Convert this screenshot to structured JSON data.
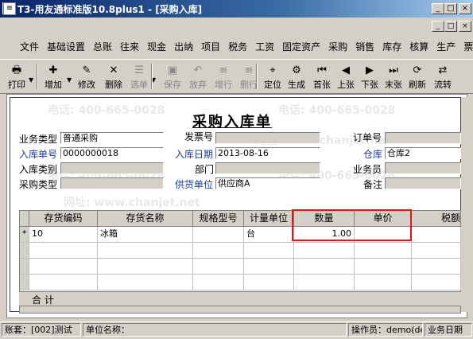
{
  "window": {
    "title": "T3-用友通标准版10.8plus1 - [采购入库]",
    "controls": [
      "_",
      "□",
      "×"
    ]
  },
  "mdi_controls": [
    "_",
    "□",
    "×"
  ],
  "menu": [
    "文件",
    "基础设置",
    "总账",
    "往来",
    "现金",
    "出纳",
    "项目",
    "税务",
    "工资",
    "固定资产",
    "采购",
    "销售",
    "库存",
    "核算",
    "生产",
    "票据"
  ],
  "toolbar": [
    {
      "label": "打印",
      "icon": "printer-icon",
      "glyph": "🖶",
      "enabled": true
    },
    {
      "label": "增加",
      "icon": "add-doc-icon",
      "glyph": "✚",
      "enabled": true
    },
    {
      "label": "修改",
      "icon": "edit-icon",
      "glyph": "✎",
      "enabled": true
    },
    {
      "label": "删除",
      "icon": "delete-icon",
      "glyph": "✕",
      "enabled": true
    },
    {
      "label": "选单",
      "icon": "select-icon",
      "glyph": "☰",
      "enabled": false
    },
    {
      "label": "保存",
      "icon": "save-icon",
      "glyph": "▣",
      "enabled": false
    },
    {
      "label": "放弃",
      "icon": "discard-icon",
      "glyph": "↶",
      "enabled": false
    },
    {
      "label": "增行",
      "icon": "add-row-icon",
      "glyph": "≡",
      "enabled": false
    },
    {
      "label": "删行",
      "icon": "delete-row-icon",
      "glyph": "≡",
      "enabled": false
    },
    {
      "label": "定位",
      "icon": "locate-icon",
      "glyph": "⌖",
      "enabled": true
    },
    {
      "label": "生成",
      "icon": "generate-icon",
      "glyph": "⚙",
      "enabled": true
    },
    {
      "label": "首张",
      "icon": "first-icon",
      "glyph": "⏮",
      "enabled": true
    },
    {
      "label": "上张",
      "icon": "prev-icon",
      "glyph": "◀",
      "enabled": true
    },
    {
      "label": "下张",
      "icon": "next-icon",
      "glyph": "▶",
      "enabled": true
    },
    {
      "label": "末张",
      "icon": "last-icon",
      "glyph": "⏭",
      "enabled": true
    },
    {
      "label": "刷新",
      "icon": "refresh-icon",
      "glyph": "⟳",
      "enabled": true
    },
    {
      "label": "流转",
      "icon": "flow-icon",
      "glyph": "⇄",
      "enabled": true
    }
  ],
  "form": {
    "title": "采购入库单",
    "fields": {
      "business_type_label": "业务类型",
      "business_type_value": "普通采购",
      "invoice_no_label": "发票号",
      "invoice_no_value": "",
      "order_no_label": "订单号",
      "order_no_value": "",
      "receipt_no_label": "入库单号",
      "receipt_no_value": "0000000018",
      "receipt_date_label": "入库日期",
      "receipt_date_value": "2013-08-16",
      "warehouse_label": "仓库",
      "warehouse_value": "仓库2",
      "receipt_category_label": "入库类别",
      "receipt_category_value": "",
      "department_label": "部门",
      "department_value": "",
      "salesperson_label": "业务员",
      "salesperson_value": "",
      "purchase_type_label": "采购类型",
      "purchase_type_value": "",
      "supplier_label": "供货单位",
      "supplier_value": "供应商A",
      "remark_label": "备注",
      "remark_value": ""
    }
  },
  "grid": {
    "columns": [
      "存货编码",
      "存货名称",
      "规格型号",
      "计量单位",
      "数量",
      "单价",
      "税额"
    ],
    "rows": [
      {
        "marker": "*",
        "code": "10",
        "name": "冰箱",
        "spec": "",
        "unit": "台",
        "qty": "1.00",
        "price": "",
        "tax": ""
      }
    ],
    "total_label": "合  计"
  },
  "statusbar": {
    "account": "账套：[002]测试",
    "unit_name": "单位名称：",
    "operator": "操作员：demo(de",
    "business_date": "业务日期"
  },
  "watermark": {
    "phone": "电话: 400-665-0028",
    "site": "网址: www.chanjet.net"
  },
  "colors": {
    "title_bar": "#0a246a",
    "highlight_box": "#e0161b",
    "blue_label": "#1a3aa0",
    "chrome": "#d4d0c8"
  }
}
